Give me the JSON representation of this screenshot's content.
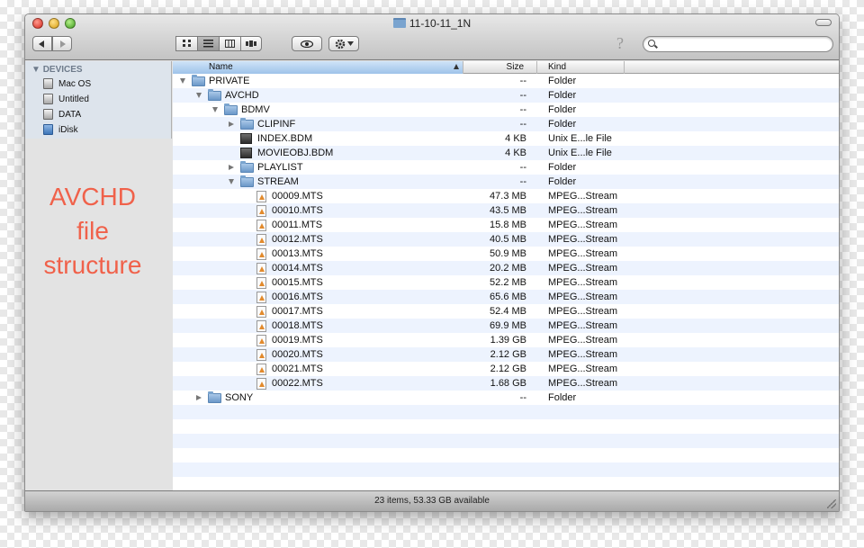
{
  "window": {
    "title": "11-10-11_1N",
    "status": "23 items, 53.33 GB available"
  },
  "toolbar": {
    "back_icon": "chevron-left-icon",
    "forward_icon": "chevron-right-icon",
    "views": [
      "icon-view-icon",
      "list-view-icon",
      "column-view-icon",
      "coverflow-view-icon"
    ],
    "active_view": "list",
    "quicklook_icon": "eye-icon",
    "action_icon": "gear-icon",
    "help_glyph": "?",
    "search_value": ""
  },
  "sidebar": {
    "heading": "DEVICES",
    "items": [
      {
        "label": "Mac OS",
        "icon": "drive-icon"
      },
      {
        "label": "Untitled",
        "icon": "drive-icon"
      },
      {
        "label": "DATA",
        "icon": "drive-icon"
      },
      {
        "label": "iDisk",
        "icon": "idisk-icon"
      }
    ]
  },
  "overlay": {
    "lines": [
      "AVCHD",
      "file",
      "structure"
    ],
    "color": "#f0614a"
  },
  "columns": {
    "name": "Name",
    "size": "Size",
    "kind": "Kind"
  },
  "rows": [
    {
      "name": "PRIVATE",
      "size": "--",
      "kind": "Folder",
      "level": 0,
      "icon": "folder",
      "disclosure": "open"
    },
    {
      "name": "AVCHD",
      "size": "--",
      "kind": "Folder",
      "level": 1,
      "icon": "folder",
      "disclosure": "open"
    },
    {
      "name": "BDMV",
      "size": "--",
      "kind": "Folder",
      "level": 2,
      "icon": "folder",
      "disclosure": "open"
    },
    {
      "name": "CLIPINF",
      "size": "--",
      "kind": "Folder",
      "level": 3,
      "icon": "folder",
      "disclosure": "closed"
    },
    {
      "name": "INDEX.BDM",
      "size": "4 KB",
      "kind": "Unix E...le File",
      "level": 3,
      "icon": "bdm",
      "disclosure": "none"
    },
    {
      "name": "MOVIEOBJ.BDM",
      "size": "4 KB",
      "kind": "Unix E...le File",
      "level": 3,
      "icon": "bdm",
      "disclosure": "none"
    },
    {
      "name": "PLAYLIST",
      "size": "--",
      "kind": "Folder",
      "level": 3,
      "icon": "folder",
      "disclosure": "closed"
    },
    {
      "name": "STREAM",
      "size": "--",
      "kind": "Folder",
      "level": 3,
      "icon": "folder",
      "disclosure": "open"
    },
    {
      "name": "00009.MTS",
      "size": "47.3 MB",
      "kind": "MPEG...Stream",
      "level": 4,
      "icon": "mts",
      "disclosure": "none"
    },
    {
      "name": "00010.MTS",
      "size": "43.5 MB",
      "kind": "MPEG...Stream",
      "level": 4,
      "icon": "mts",
      "disclosure": "none"
    },
    {
      "name": "00011.MTS",
      "size": "15.8 MB",
      "kind": "MPEG...Stream",
      "level": 4,
      "icon": "mts",
      "disclosure": "none"
    },
    {
      "name": "00012.MTS",
      "size": "40.5 MB",
      "kind": "MPEG...Stream",
      "level": 4,
      "icon": "mts",
      "disclosure": "none"
    },
    {
      "name": "00013.MTS",
      "size": "50.9 MB",
      "kind": "MPEG...Stream",
      "level": 4,
      "icon": "mts",
      "disclosure": "none"
    },
    {
      "name": "00014.MTS",
      "size": "20.2 MB",
      "kind": "MPEG...Stream",
      "level": 4,
      "icon": "mts",
      "disclosure": "none"
    },
    {
      "name": "00015.MTS",
      "size": "52.2 MB",
      "kind": "MPEG...Stream",
      "level": 4,
      "icon": "mts",
      "disclosure": "none"
    },
    {
      "name": "00016.MTS",
      "size": "65.6 MB",
      "kind": "MPEG...Stream",
      "level": 4,
      "icon": "mts",
      "disclosure": "none"
    },
    {
      "name": "00017.MTS",
      "size": "52.4 MB",
      "kind": "MPEG...Stream",
      "level": 4,
      "icon": "mts",
      "disclosure": "none"
    },
    {
      "name": "00018.MTS",
      "size": "69.9 MB",
      "kind": "MPEG...Stream",
      "level": 4,
      "icon": "mts",
      "disclosure": "none"
    },
    {
      "name": "00019.MTS",
      "size": "1.39 GB",
      "kind": "MPEG...Stream",
      "level": 4,
      "icon": "mts",
      "disclosure": "none"
    },
    {
      "name": "00020.MTS",
      "size": "2.12 GB",
      "kind": "MPEG...Stream",
      "level": 4,
      "icon": "mts",
      "disclosure": "none"
    },
    {
      "name": "00021.MTS",
      "size": "2.12 GB",
      "kind": "MPEG...Stream",
      "level": 4,
      "icon": "mts",
      "disclosure": "none"
    },
    {
      "name": "00022.MTS",
      "size": "1.68 GB",
      "kind": "MPEG...Stream",
      "level": 4,
      "icon": "mts",
      "disclosure": "none"
    },
    {
      "name": "SONY",
      "size": "--",
      "kind": "Folder",
      "level": 1,
      "icon": "folder",
      "disclosure": "closed"
    }
  ]
}
